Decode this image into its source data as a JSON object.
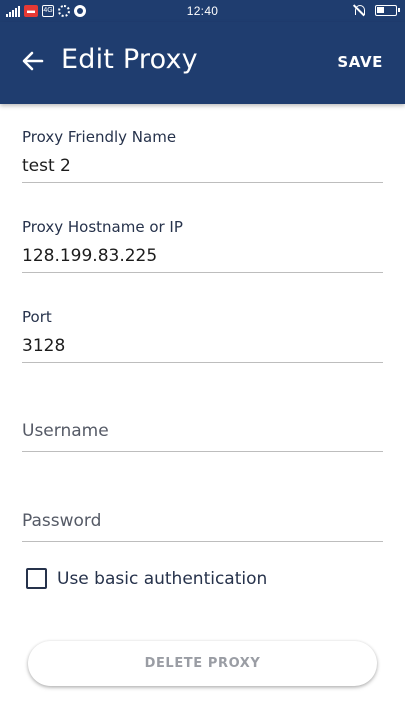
{
  "status_bar": {
    "time": "12:40",
    "notification_badge": "ꟷ",
    "signal_icon": "signal-icon",
    "battery_icon": "battery-icon"
  },
  "app_bar": {
    "title": "Edit Proxy",
    "save_label": "SAVE",
    "background_color": "#1f3d6f"
  },
  "form": {
    "friendly_name": {
      "label": "Proxy Friendly Name",
      "value": "test 2"
    },
    "hostname": {
      "label": "Proxy Hostname or IP",
      "value": "128.199.83.225"
    },
    "port": {
      "label": "Port",
      "value": "3128"
    },
    "username": {
      "placeholder": "Username",
      "value": ""
    },
    "password": {
      "placeholder": "Password",
      "value": ""
    },
    "basic_auth": {
      "label": "Use basic authentication",
      "checked": false
    }
  },
  "delete_button": {
    "label": "DELETE PROXY"
  }
}
